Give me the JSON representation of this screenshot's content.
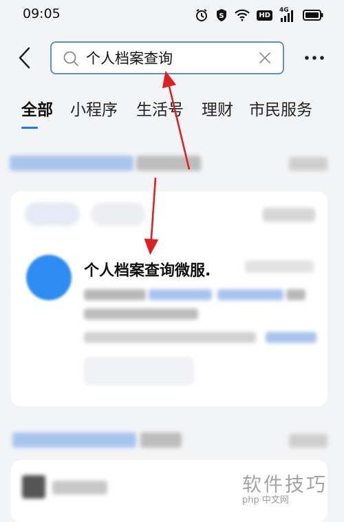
{
  "status_bar": {
    "time": "09:05",
    "icons": [
      "alarm-icon",
      "shield-s-icon",
      "wifi-icon",
      "hd-icon",
      "signal-4g-icon",
      "battery-icon"
    ],
    "hd_label": "HD",
    "network_label": "4G"
  },
  "search": {
    "query": "个人档案查询",
    "placeholder": "",
    "accent_color": "#5f8fc4"
  },
  "tabs": [
    {
      "label": "全部",
      "active": true
    },
    {
      "label": "小程序",
      "active": false
    },
    {
      "label": "生活号",
      "active": false
    },
    {
      "label": "理财",
      "active": false
    },
    {
      "label": "市民服务",
      "active": false
    }
  ],
  "result_card": {
    "title": "个人档案查询微服."
  },
  "annotation": {
    "arrow_color": "#e02020"
  },
  "watermark": {
    "text": "软件技巧",
    "sub": "php 中文网"
  },
  "colors": {
    "accent": "#1677ff",
    "background": "#f3f4f6"
  }
}
